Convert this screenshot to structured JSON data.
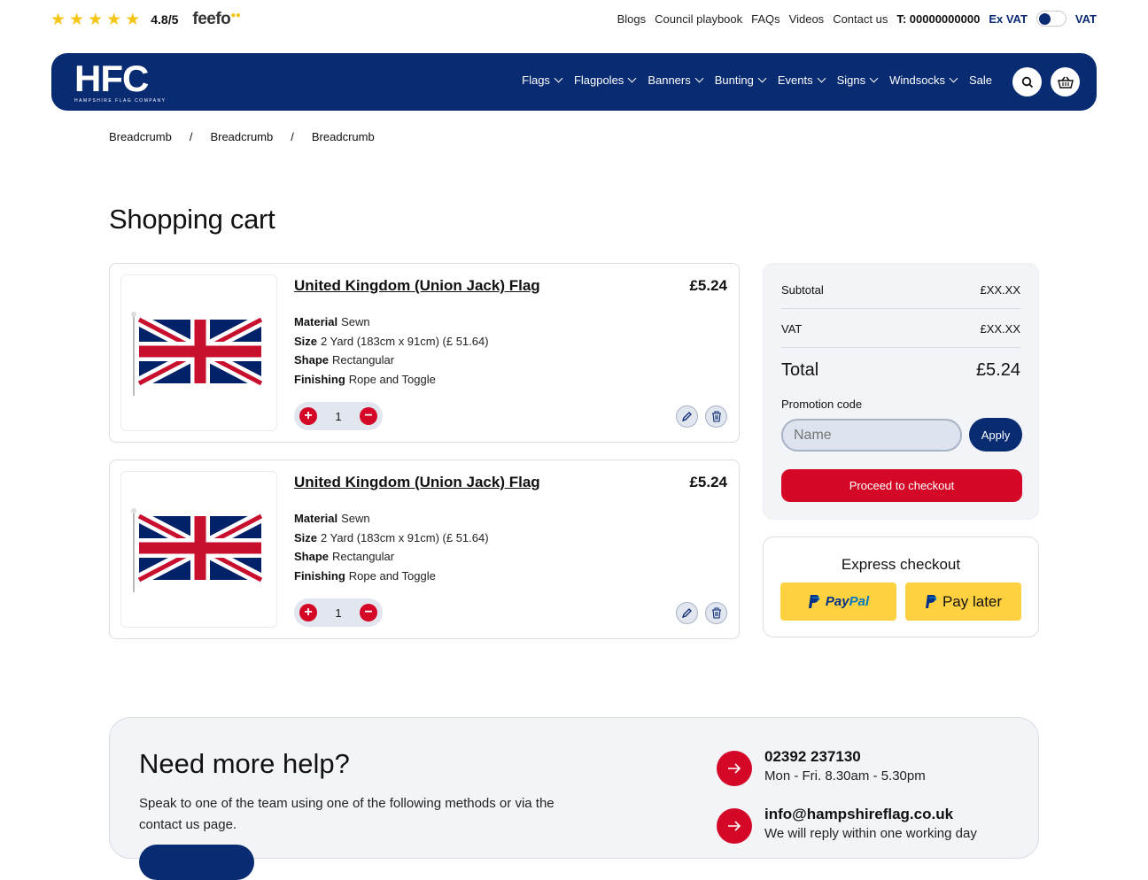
{
  "rating": {
    "stars": 5,
    "score": "4.8/5",
    "brand": "feefo"
  },
  "toplinks": [
    "Blogs",
    "Council playbook",
    "FAQs",
    "Videos",
    "Contact us"
  ],
  "phone": "T: 00000000000",
  "vat": {
    "ex_label": "Ex VAT",
    "inc_label": "VAT"
  },
  "logo": {
    "mark": "HFC",
    "sub": "HAMPSHIRE FLAG COMPANY"
  },
  "nav": [
    "Flags",
    "Flagpoles",
    "Banners",
    "Bunting",
    "Events",
    "Signs",
    "Windsocks",
    "Sale"
  ],
  "breadcrumbs": [
    "Breadcrumb",
    "/",
    "Breadcrumb",
    "/",
    "Breadcrumb"
  ],
  "title": "Shopping cart",
  "items": [
    {
      "title": "United Kingdom (Union Jack) Flag",
      "price": "£5.24",
      "attrs": [
        {
          "k": "Material",
          "v": "Sewn"
        },
        {
          "k": "Size",
          "v": "2 Yard (183cm x 91cm) (£ 51.64)"
        },
        {
          "k": "Shape",
          "v": "Rectangular"
        },
        {
          "k": "Finishing",
          "v": "Rope and Toggle"
        }
      ],
      "qty": "1"
    },
    {
      "title": "United Kingdom (Union Jack) Flag",
      "price": "£5.24",
      "attrs": [
        {
          "k": "Material",
          "v": "Sewn"
        },
        {
          "k": "Size",
          "v": "2 Yard (183cm x 91cm) (£ 51.64)"
        },
        {
          "k": "Shape",
          "v": "Rectangular"
        },
        {
          "k": "Finishing",
          "v": "Rope and Toggle"
        }
      ],
      "qty": "1"
    }
  ],
  "summary": {
    "subtotal_label": "Subtotal",
    "subtotal_value": "£XX.XX",
    "vat_label": "VAT",
    "vat_value": "£XX.XX",
    "total_label": "Total",
    "total_value": "£5.24",
    "promo_label": "Promotion code",
    "promo_placeholder": "Name",
    "apply_label": "Apply",
    "checkout_label": "Proceed to checkout"
  },
  "express": {
    "title": "Express checkout",
    "paypal": "PayPal",
    "paylater": "Pay later"
  },
  "help": {
    "title": "Need more help?",
    "text": "Speak to one of the team using one of the following methods or via the contact us page.",
    "phone": "02392 237130",
    "phone_hours": "Mon - Fri. 8.30am - 5.30pm",
    "email": "info@hampshireflag.co.uk",
    "email_note": "We will reply within one working day"
  },
  "colors": {
    "navy": "#082b72",
    "red": "#d40826",
    "yellow": "#ffd140",
    "star": "#f5c518"
  }
}
